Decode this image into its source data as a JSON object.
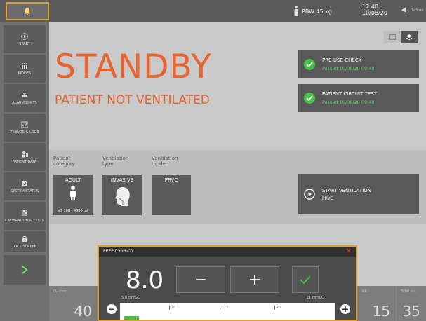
{
  "topbar": {
    "patient_weight": "PBW 45 kg",
    "time": "12:40",
    "date": "10/08/20",
    "right_sub": "145 mi"
  },
  "sidebar": {
    "items": [
      {
        "label": "START",
        "icon": "play-circle-icon"
      },
      {
        "label": "MODES",
        "icon": "grid-icon"
      },
      {
        "label": "ALARM LIMITS",
        "icon": "alarm-icon"
      },
      {
        "label": "TRENDS & LOGS",
        "icon": "trends-icon"
      },
      {
        "label": "PATIENT DATA",
        "icon": "patient-icon"
      },
      {
        "label": "SYSTEM STATUS",
        "icon": "system-icon"
      },
      {
        "label": "CALIBRATION & TESTS",
        "icon": "calibration-icon"
      },
      {
        "label": "LOCK SCREEN",
        "icon": "lock-icon"
      }
    ],
    "next_icon": "chevron-right-icon"
  },
  "main": {
    "status_title": "STANDBY",
    "status_subtitle": "PATIENT NOT VENTILATED",
    "checks": [
      {
        "title": "PRE-USE CHECK",
        "status": "Passed 10/08/20 09:40"
      },
      {
        "title": "PATIENT CIRCUIT TEST",
        "status": "Passed 10/08/20 09:40"
      }
    ],
    "settings": {
      "labels": [
        "Patient category",
        "Ventilation type",
        "Ventilation mode"
      ],
      "category_value": "ADULT",
      "category_sub": "VT 100 - 4000 ml",
      "type_value": "INVASIVE",
      "mode_value": "PRVC"
    },
    "start": {
      "title": "START VENTILATION",
      "mode": "PRVC"
    }
  },
  "bottom": {
    "cells": [
      {
        "label": "O₂ conc.",
        "value": "40"
      },
      {
        "label": "RR",
        "value": "15"
      },
      {
        "label": "Tidal vol.",
        "value": "35"
      }
    ]
  },
  "peep_popup": {
    "title": "PEEP (cmH₂O)",
    "value": "8.0",
    "minus": "−",
    "plus": "+",
    "min_label": "5.0 cmH₂O",
    "max_label": "21 cmH₂O",
    "ticks": [
      "10",
      "15",
      "20"
    ],
    "level_fraction": 0.07,
    "colors": {
      "accent": "#e8642e",
      "ok": "#4cc24c",
      "highlight": "#e0a02e"
    }
  }
}
